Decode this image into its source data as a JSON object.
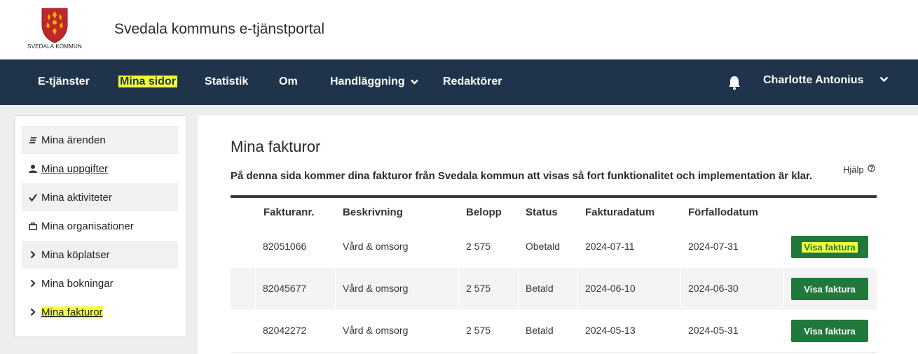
{
  "header": {
    "logo_text": "SVEDALA KOMMUN",
    "site_title": "Svedala kommuns e-tjänstportal"
  },
  "nav": {
    "items": [
      {
        "label": "E-tjänster"
      },
      {
        "label": "Mina sidor",
        "active": true
      },
      {
        "label": "Statistik"
      },
      {
        "label": "Om"
      },
      {
        "label": "Handläggning",
        "has_dropdown": true
      },
      {
        "label": "Redaktörer"
      }
    ],
    "bell_icon": "bell-icon",
    "user_name": "Charlotte Antonius"
  },
  "sidebar": {
    "items": [
      {
        "label": "Mina ärenden",
        "icon": "list-icon"
      },
      {
        "label": "Mina uppgifter",
        "icon": "person-icon"
      },
      {
        "label": "Mina aktiviteter",
        "icon": "check-icon"
      },
      {
        "label": "Mina organisationer",
        "icon": "briefcase-icon"
      },
      {
        "label": "Mina köplatser",
        "icon": "chevron-right-icon"
      },
      {
        "label": "Mina bokningar",
        "icon": "chevron-right-icon"
      },
      {
        "label": "Mina fakturor",
        "icon": "chevron-right-icon",
        "active": true
      }
    ]
  },
  "main": {
    "title": "Mina fakturor",
    "help_label": "Hjälp",
    "intro": "På denna sida kommer dina fakturor från Svedala kommun att visas så fort funktionalitet och implementation är klar.",
    "columns": [
      "Fakturanr.",
      "Beskrivning",
      "Belopp",
      "Status",
      "Fakturadatum",
      "Förfallodatum"
    ],
    "rows": [
      {
        "nr": "82051066",
        "desc": "Vård & omsorg",
        "amount": "2 575",
        "status": "Obetald",
        "date": "2024-07-11",
        "due": "2024-07-31",
        "action": "Visa faktura"
      },
      {
        "nr": "82045677",
        "desc": "Vård & omsorg",
        "amount": "2 575",
        "status": "Betald",
        "date": "2024-06-10",
        "due": "2024-06-30",
        "action": "Visa faktura"
      },
      {
        "nr": "82042272",
        "desc": "Vård & omsorg",
        "amount": "2 575",
        "status": "Betald",
        "date": "2024-05-13",
        "due": "2024-05-31",
        "action": "Visa faktura"
      }
    ]
  },
  "colors": {
    "nav_bg": "#1f344a",
    "highlight": "#f6ff3a",
    "button_green": "#20783a",
    "logo_red": "#c0272d",
    "logo_gold": "#f2b705"
  }
}
